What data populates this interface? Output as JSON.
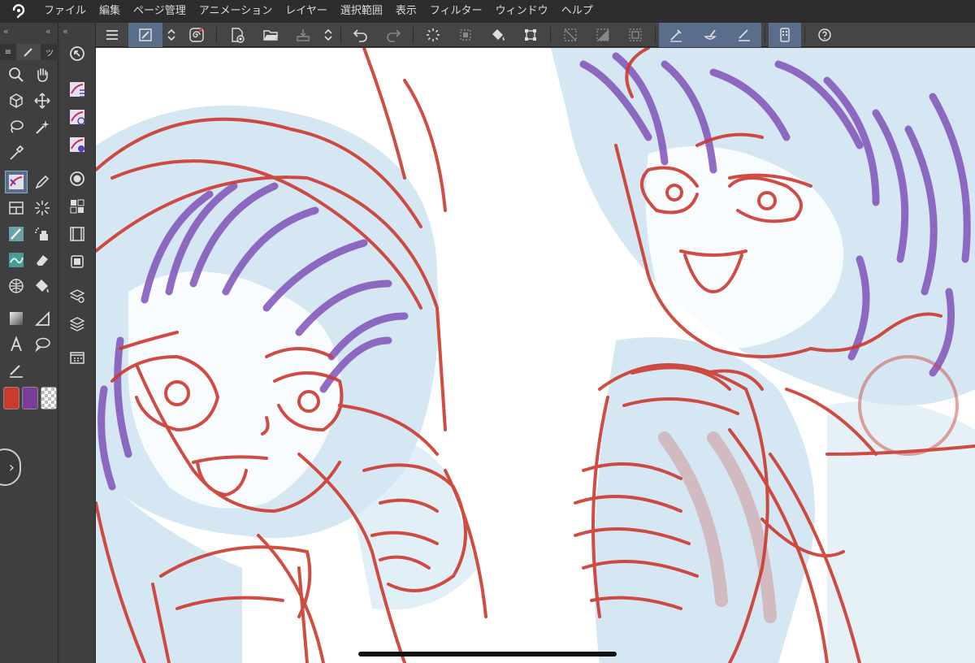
{
  "menu": {
    "items": [
      "ファイル",
      "編集",
      "ページ管理",
      "アニメーション",
      "レイヤー",
      "選択範囲",
      "表示",
      "フィルター",
      "ウィンドウ",
      "ヘルプ"
    ]
  },
  "panel_tabs": {
    "tool_tab_glyph": "ツ"
  },
  "colors": {
    "main_color": "#cc3a2e",
    "sub_color": "#7a3d9a",
    "accent": "#5a6d8a"
  },
  "command_icons": [
    "menu-icon",
    "selected-tool-icon",
    "expand-icon",
    "spiral-icon",
    "new-page-icon",
    "open-icon",
    "save-icon",
    "expand-icon",
    "undo-icon",
    "redo-icon",
    "loading-icon",
    "clear-icon",
    "fill-icon",
    "transform-icon",
    "deselect-icon",
    "invert-selection-icon",
    "selection-border-icon",
    "ruler-pen-icon",
    "ruler-brush-icon",
    "ruler-icon",
    "tablet-icon",
    "help-icon"
  ]
}
